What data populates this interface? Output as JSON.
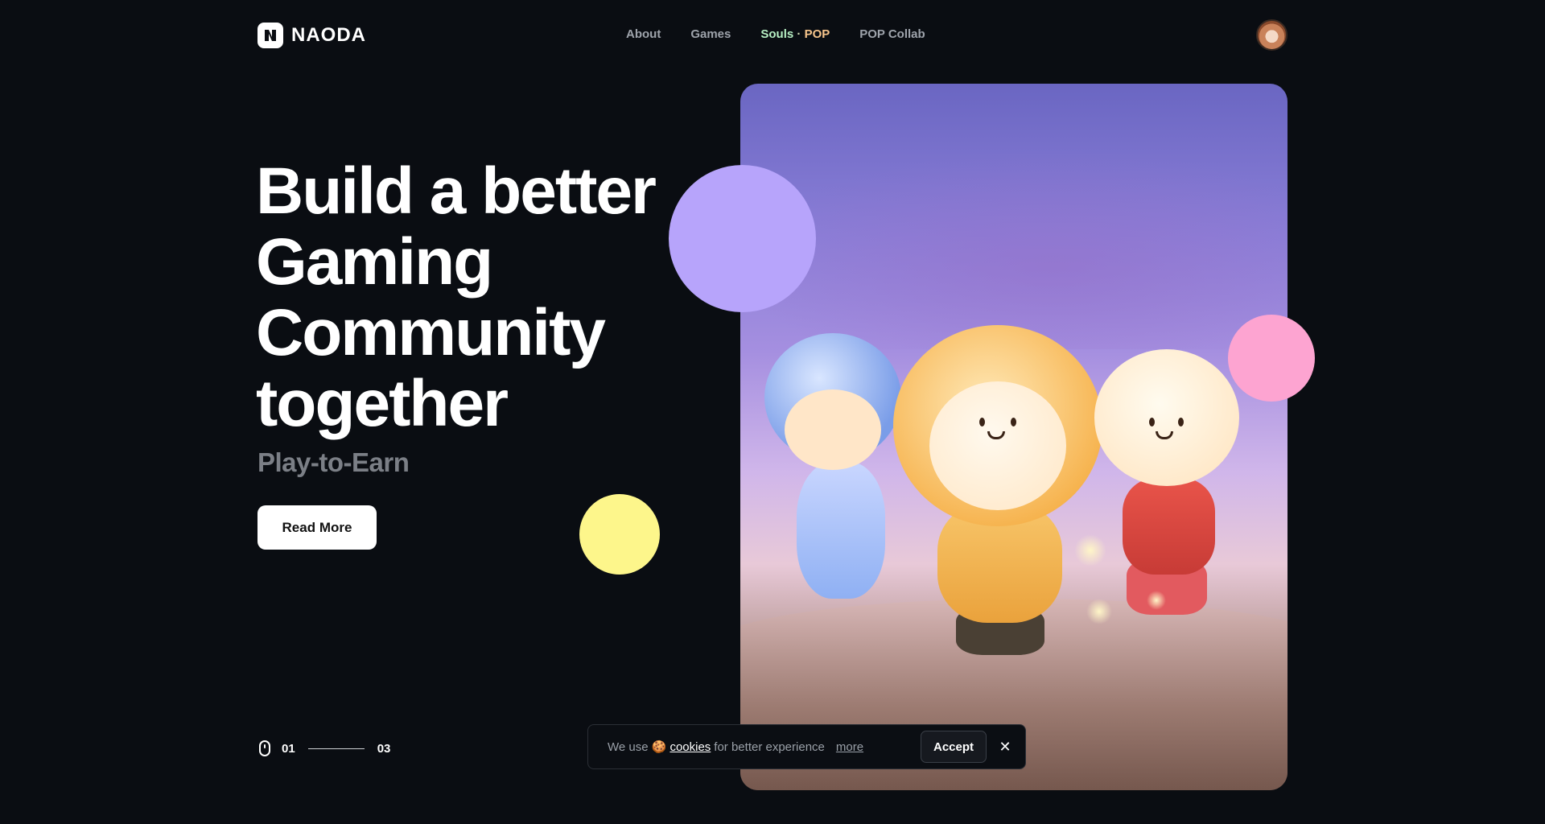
{
  "header": {
    "logo_text": "NAODA",
    "nav": [
      {
        "label": "About"
      },
      {
        "label": "Games"
      },
      {
        "label_souls": "Souls",
        "label_dot": " · ",
        "label_pop": "POP"
      },
      {
        "label": "POP Collab"
      }
    ]
  },
  "hero": {
    "title_lines": [
      "Build a better",
      "Gaming",
      "Community",
      "together"
    ],
    "subtitle": "Play-to-Earn",
    "cta_label": "Read More"
  },
  "slider": {
    "current": "01",
    "total": "03"
  },
  "cookie": {
    "prefix": "We use 🍪",
    "link": "cookies",
    "suffix": "for better experience",
    "more": "more",
    "accept": "Accept",
    "close_glyph": "✕"
  },
  "colors": {
    "background": "#0a0d12",
    "circle_purple": "#b7a4fb",
    "circle_yellow": "#fdf68b",
    "circle_pink": "#fda4d1"
  }
}
